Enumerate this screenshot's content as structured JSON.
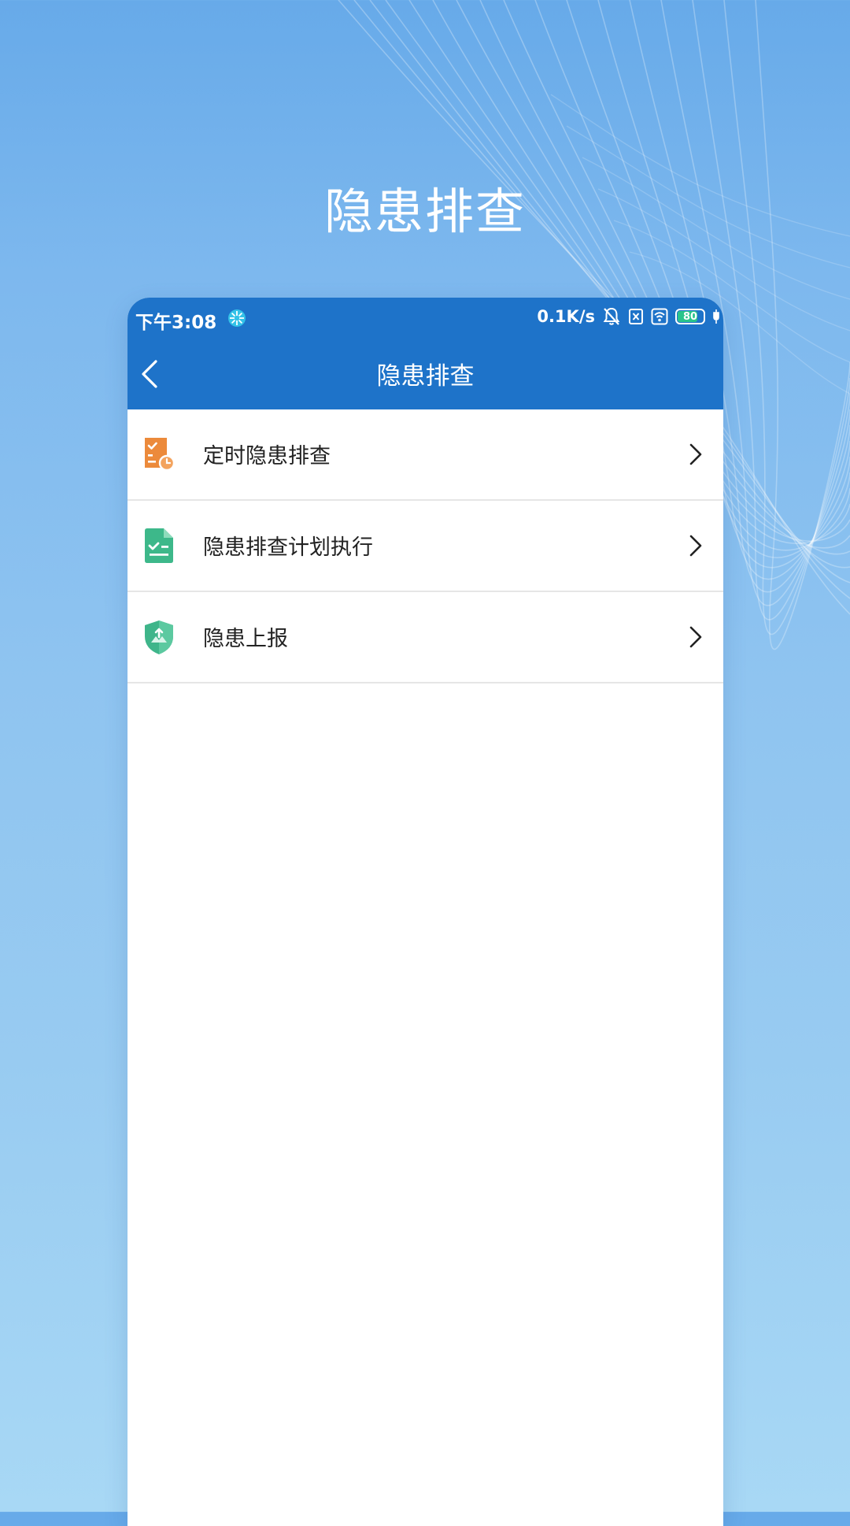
{
  "hero": {
    "title": "隐患排查"
  },
  "status_bar": {
    "time": "下午3:08",
    "net_speed": "0.1K/s",
    "battery_level": "80",
    "battery_fraction": 0.8,
    "icons": [
      "app-notification-icon",
      "mute-bell-icon",
      "sim-off-icon",
      "wifi-icon",
      "battery-icon",
      "charging-icon"
    ]
  },
  "nav": {
    "title": "隐患排查",
    "back_icon": "back-arrow-icon"
  },
  "menu": [
    {
      "label": "定时隐患排查",
      "icon": "scheduled-check-icon",
      "icon_color": "#ec8a3b"
    },
    {
      "label": "隐患排查计划执行",
      "icon": "plan-checklist-icon",
      "icon_color": "#3db88a"
    },
    {
      "label": "隐患上报",
      "icon": "report-shield-icon",
      "icon_color": "#3fb58a"
    }
  ],
  "colors": {
    "app_bar": "#1e73c9",
    "background_top": "#67aae9",
    "background_bottom": "#a8d8f5"
  }
}
